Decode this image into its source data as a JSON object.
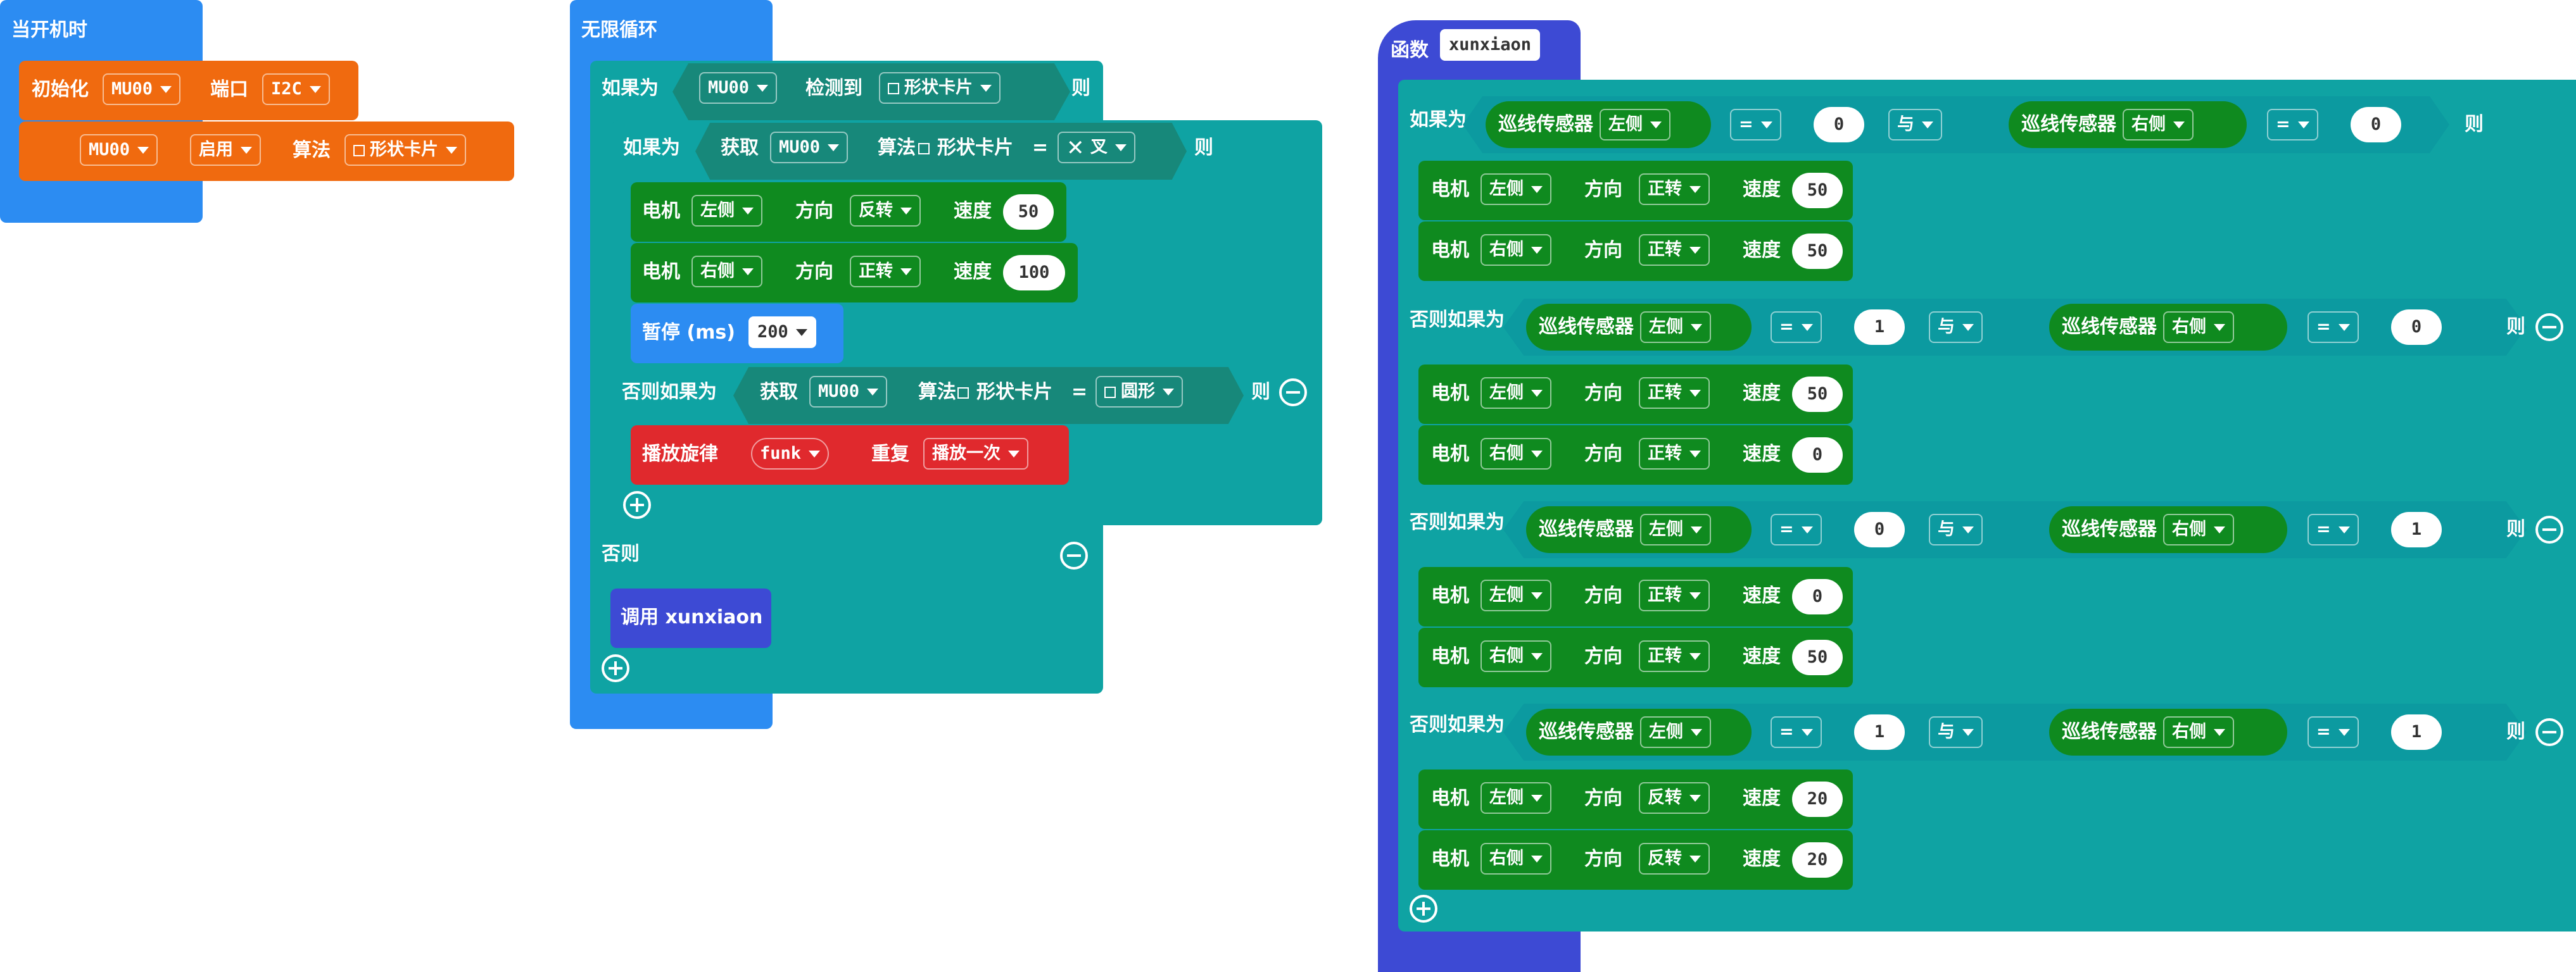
{
  "colors": {
    "event_blue": "#2c8cf2",
    "control_teal": "#0fa3a3",
    "sensor_orange": "#f06a0f",
    "motor_green": "#0f8a1f",
    "music_red": "#e0292d",
    "function_indigo": "#3d4ad4"
  },
  "on_start": {
    "hat": "当开机时",
    "init_label": "初始化",
    "init_device": "MU00",
    "port_label": "端口",
    "port_value": "I2C",
    "device": "MU00",
    "enable_value": "启用",
    "algo_label": "算法",
    "algo_value": "形状卡片"
  },
  "forever": {
    "hat": "无限循环",
    "if_label": "如果为",
    "then_label": "则",
    "detect_device": "MU00",
    "detect_label": "检测到",
    "detect_value": "形状卡片",
    "inner_if_label": "如果为",
    "get_label": "获取",
    "get_device": "MU00",
    "algo_label": "算法",
    "algo_value": "形状卡片",
    "eq": "=",
    "cross_value": "叉",
    "motor_label": "电机",
    "direction_label": "方向",
    "speed_label": "速度",
    "motor1": {
      "side": "左侧",
      "dir": "反转",
      "speed": "50"
    },
    "motor2": {
      "side": "右侧",
      "dir": "正转",
      "speed": "100"
    },
    "pause_label": "暂停 (ms)",
    "pause_value": "200",
    "elseif_label": "否则如果为",
    "get2_label": "获取",
    "get2_device": "MU00",
    "algo2_label": "算法",
    "algo2_value": "形状卡片",
    "eq2": "=",
    "circle_value": "圆形",
    "melody_label": "播放旋律",
    "melody_value": "funk",
    "repeat_label": "重复",
    "repeat_value": "播放一次",
    "else_label": "否则",
    "call_label": "调用 xunxiaon"
  },
  "function": {
    "hat": "函数",
    "name": "xunxiaon",
    "if_label": "如果为",
    "elseif_label": "否则如果为",
    "then_label": "则",
    "sensor_label": "巡线传感器",
    "left": "左侧",
    "right": "右侧",
    "eq": "=",
    "and_label": "与",
    "motor_label": "电机",
    "direction_label": "方向",
    "speed_label": "速度",
    "conditions": [
      {
        "l": "0",
        "r": "0"
      },
      {
        "l": "1",
        "r": "0"
      },
      {
        "l": "0",
        "r": "1"
      },
      {
        "l": "1",
        "r": "1"
      }
    ],
    "motors": [
      {
        "a": {
          "side": "左侧",
          "dir": "正转",
          "speed": "50"
        },
        "b": {
          "side": "右侧",
          "dir": "正转",
          "speed": "50"
        }
      },
      {
        "a": {
          "side": "左侧",
          "dir": "正转",
          "speed": "50"
        },
        "b": {
          "side": "右侧",
          "dir": "正转",
          "speed": "0"
        }
      },
      {
        "a": {
          "side": "左侧",
          "dir": "正转",
          "speed": "0"
        },
        "b": {
          "side": "右侧",
          "dir": "正转",
          "speed": "50"
        }
      },
      {
        "a": {
          "side": "左侧",
          "dir": "反转",
          "speed": "20"
        },
        "b": {
          "side": "右侧",
          "dir": "反转",
          "speed": "20"
        }
      }
    ]
  }
}
